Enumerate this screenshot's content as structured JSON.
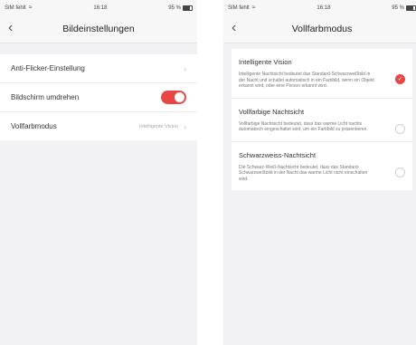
{
  "left": {
    "status": {
      "carrier": "SIM fehlt",
      "time": "16:18",
      "battery": "95 %"
    },
    "nav": {
      "back_icon": "chevron-left-icon",
      "title": "Bildeinstellungen"
    },
    "settings": [
      {
        "label": "Anti-Flicker-Einstellung"
      },
      {
        "label": "Bildschirm umdrehen",
        "toggle_on": true
      },
      {
        "label": "Vollfarbmodus",
        "value": "Intelligente Vision"
      }
    ]
  },
  "right": {
    "status": {
      "carrier": "SIM fehlt",
      "time": "16:18",
      "battery": "95 %"
    },
    "nav": {
      "back_icon": "chevron-left-icon",
      "title": "Vollfarbmodus"
    },
    "modes": [
      {
        "title": "Intelligente Vision",
        "description": "Intelligente Nachtsicht bedeutet das Standard-Schwarzweißbild in der Nacht und schaltet automatisch in ein Farbbild, wenn ein Objekt erkannt wird, oder eine Person erkannt wird.",
        "selected": true
      },
      {
        "title": "Vollfarbige Nachtsicht",
        "description": "Vollfarbige Nachtsicht bedeutet, dass das warme Licht nachts automatisch eingeschaltet wird, um ein Farbbild zu präsentieren.",
        "selected": false
      },
      {
        "title": "Schwarzweiss-Nachtsicht",
        "description": "Die Schwarz-Weiß-Nachtsicht bedeutet, dass das Standard-Schwarzweißbild in der Nacht das warme Licht nicht einschalten wird.",
        "selected": false
      }
    ]
  },
  "colors": {
    "accent": "#e84545",
    "background": "#f2f2f4"
  }
}
